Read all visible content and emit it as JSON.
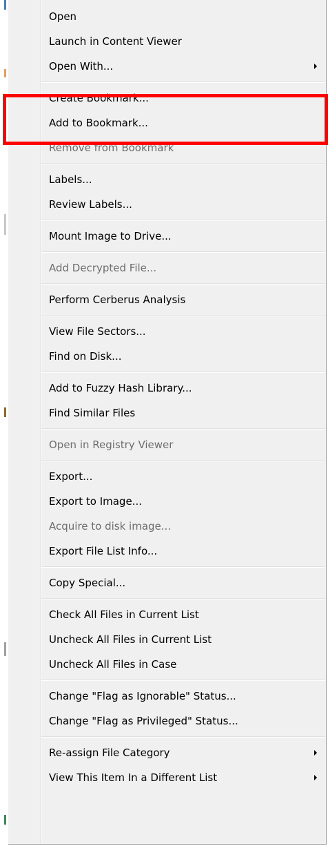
{
  "highlight_color": "#ff0000",
  "menu": {
    "groups": [
      [
        {
          "label": "Open",
          "enabled": true
        },
        {
          "label": "Launch in Content Viewer",
          "enabled": true
        },
        {
          "label": "Open With...",
          "enabled": true,
          "submenu": true
        }
      ],
      [
        {
          "label": "Create Bookmark...",
          "enabled": true
        },
        {
          "label": "Add to Bookmark...",
          "enabled": true
        },
        {
          "label": "Remove from Bookmark",
          "enabled": false
        }
      ],
      [
        {
          "label": "Labels...",
          "enabled": true
        },
        {
          "label": "Review Labels...",
          "enabled": true
        }
      ],
      [
        {
          "label": "Mount Image to Drive...",
          "enabled": true
        }
      ],
      [
        {
          "label": "Add Decrypted File...",
          "enabled": false
        }
      ],
      [
        {
          "label": "Perform Cerberus Analysis",
          "enabled": true
        }
      ],
      [
        {
          "label": "View File Sectors...",
          "enabled": true
        },
        {
          "label": "Find on Disk...",
          "enabled": true
        }
      ],
      [
        {
          "label": "Add to Fuzzy Hash Library...",
          "enabled": true
        },
        {
          "label": "Find Similar Files",
          "enabled": true
        }
      ],
      [
        {
          "label": "Open in Registry Viewer",
          "enabled": false
        }
      ],
      [
        {
          "label": "Export...",
          "enabled": true
        },
        {
          "label": "Export to Image...",
          "enabled": true
        },
        {
          "label": "Acquire to disk image...",
          "enabled": false
        },
        {
          "label": "Export File List Info...",
          "enabled": true
        }
      ],
      [
        {
          "label": "Copy Special...",
          "enabled": true
        }
      ],
      [
        {
          "label": "Check All Files in Current List",
          "enabled": true
        },
        {
          "label": "Uncheck All Files in Current List",
          "enabled": true
        },
        {
          "label": "Uncheck All Files in Case",
          "enabled": true
        }
      ],
      [
        {
          "label": "Change \"Flag as Ignorable\" Status...",
          "enabled": true
        },
        {
          "label": "Change \"Flag as Privileged\" Status...",
          "enabled": true
        }
      ],
      [
        {
          "label": "Re-assign File Category",
          "enabled": true,
          "submenu": true
        },
        {
          "label": "View This Item In a Different List",
          "enabled": true,
          "submenu": true
        }
      ]
    ]
  }
}
